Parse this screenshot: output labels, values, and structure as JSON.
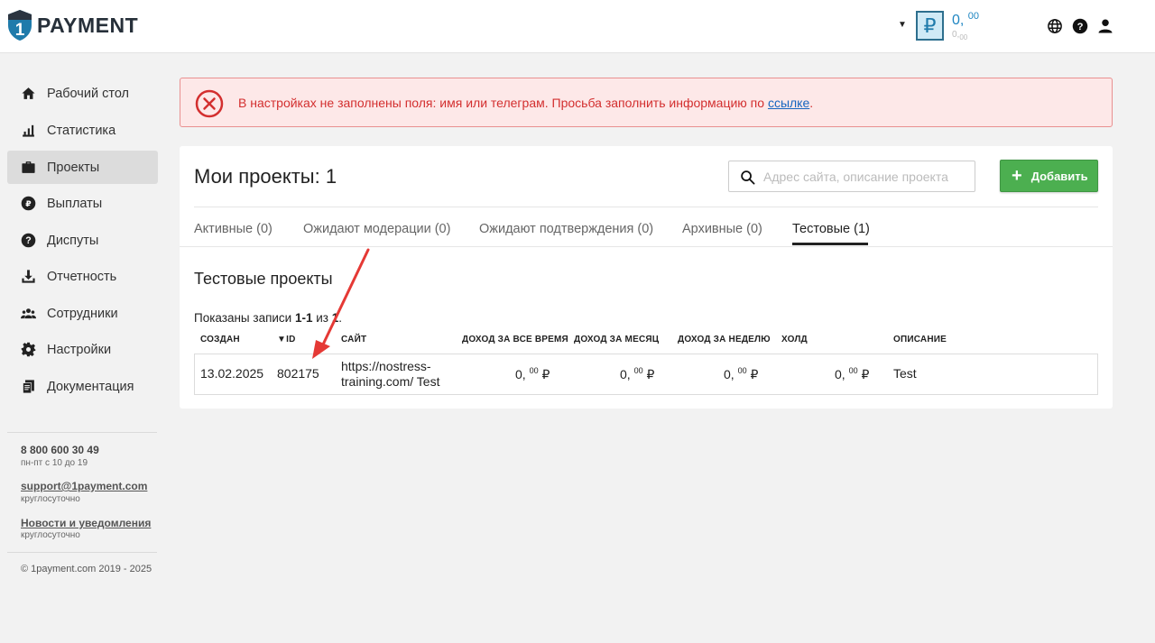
{
  "header": {
    "logo_text": "PAYMENT",
    "logo_number": "1",
    "balance_currency": "₽",
    "balance_main": "0,",
    "balance_main_cents": "00",
    "balance_sub": "0,",
    "balance_sub_cents": "00",
    "icons": [
      "globe-icon",
      "help-icon",
      "user-icon"
    ]
  },
  "sidebar": {
    "items": [
      {
        "label": "Рабочий стол",
        "icon": "home-icon"
      },
      {
        "label": "Статистика",
        "icon": "bar-chart-icon"
      },
      {
        "label": "Проекты",
        "icon": "briefcase-icon",
        "active": true
      },
      {
        "label": "Выплаты",
        "icon": "ruble-icon"
      },
      {
        "label": "Диспуты",
        "icon": "help-circle-icon"
      },
      {
        "label": "Отчетность",
        "icon": "download-icon"
      },
      {
        "label": "Сотрудники",
        "icon": "people-icon"
      },
      {
        "label": "Настройки",
        "icon": "gear-icon"
      },
      {
        "label": "Документация",
        "icon": "documents-icon"
      }
    ],
    "phone": "8 800 600 30 49",
    "phone_hours": "пн-пт с 10 до 19",
    "email": "support@1payment.com",
    "email_hours": "круглосуточно",
    "news": "Новости и уведомления",
    "news_hours": "круглосуточно",
    "copyright": "© 1payment.com 2019 - 2025"
  },
  "alert": {
    "text": "В настройках не заполнены поля: имя или телеграм. Просьба заполнить информацию по ",
    "link": "ссылке",
    "end": "."
  },
  "main": {
    "title": "Мои проекты: 1",
    "search_placeholder": "Адрес сайта, описание проекта",
    "add_label": "Добавить",
    "tabs": [
      {
        "label": "Активные (0)"
      },
      {
        "label": "Ожидают модерации (0)"
      },
      {
        "label": "Ожидают подтверждения (0)"
      },
      {
        "label": "Архивные (0)"
      },
      {
        "label": "Тестовые (1)",
        "active": true
      }
    ],
    "section_title": "Тестовые проекты",
    "shown_prefix": "Показаны записи ",
    "shown_range": "1-1",
    "shown_of": " из ",
    "shown_total": "1",
    "shown_end": ".",
    "columns": [
      "СОЗДАН",
      "▼ID",
      "САЙТ",
      "ДОХОД ЗА ВСЕ ВРЕМЯ",
      "ДОХОД ЗА МЕСЯЦ",
      "ДОХОД ЗА НЕДЕЛЮ",
      "ХОЛД",
      "ОПИСАНИЕ"
    ],
    "rows": [
      {
        "created": "13.02.2025",
        "id": "802175",
        "site_line1": "https://nostress-",
        "site_line2": "training.com/ Test",
        "income_all": "0,",
        "income_month": "0,",
        "income_week": "0,",
        "hold": "0,",
        "cents": "00",
        "currency": "₽",
        "description": "Test"
      }
    ]
  },
  "colors": {
    "accent_blue": "#1f86c2",
    "add_green": "#4caf50",
    "alert_red": "#d32f2f",
    "annotation_arrow": "#e53935"
  }
}
